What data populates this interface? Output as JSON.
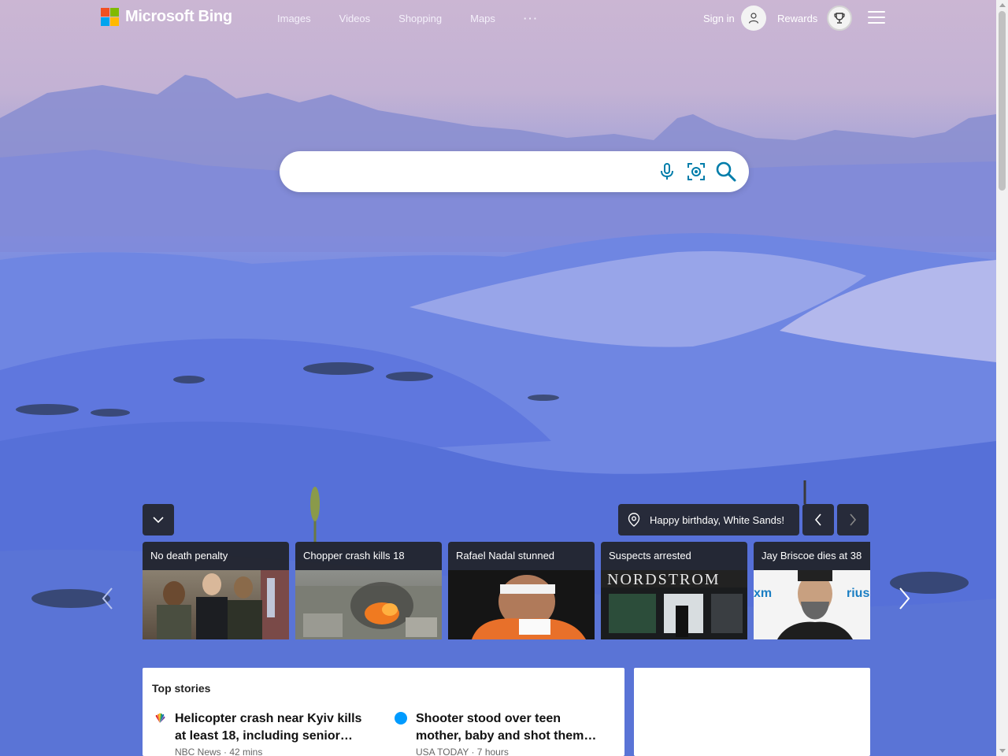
{
  "header": {
    "brand": "Microsoft Bing",
    "nav": [
      "Images",
      "Videos",
      "Shopping",
      "Maps"
    ],
    "more": "···",
    "sign_in": "Sign in",
    "rewards": "Rewards"
  },
  "search": {
    "value": "",
    "placeholder": ""
  },
  "background": {
    "caption": "Happy birthday, White Sands!"
  },
  "news_cards": [
    {
      "title": "No death penalty"
    },
    {
      "title": "Chopper crash kills 18"
    },
    {
      "title": "Rafael Nadal stunned"
    },
    {
      "title": "Suspects arrested"
    },
    {
      "title": "Jay Briscoe dies at 38"
    }
  ],
  "card_image_text": {
    "nordstrom": "NORDSTROM",
    "siriusxm": "xm",
    "sirius": "rius"
  },
  "top_stories": {
    "heading": "Top stories",
    "items": [
      {
        "headline": "Helicopter crash near Kyiv kills at least 18, including senior…",
        "source": "NBC News",
        "time": "42 mins",
        "meta": "NBC News · 42 mins"
      },
      {
        "headline": "Shooter stood over teen mother, baby and shot them…",
        "source": "USA TODAY",
        "time": "7 hours",
        "meta": "USA TODAY · 7 hours"
      }
    ]
  },
  "colors": {
    "bing_teal": "#007daa",
    "overlay_dark": "#1e1e1e"
  },
  "icons": {
    "mic": "microphone-icon",
    "visual": "visual-search-icon",
    "search": "search-icon",
    "location": "location-pin-icon"
  }
}
